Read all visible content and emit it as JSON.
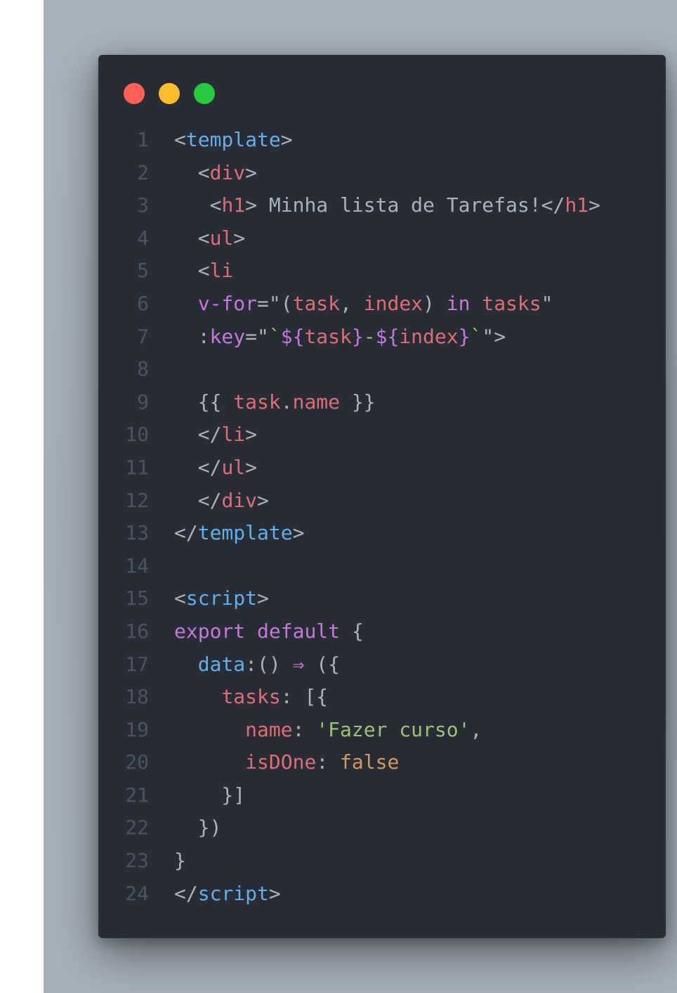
{
  "window_controls": {
    "close_color": "#ff5f56",
    "minimize_color": "#ffbd2e",
    "maximize_color": "#27c93f"
  },
  "code_lines": [
    {
      "n": "1",
      "tokens": [
        [
          "t-pun",
          "<"
        ],
        [
          "t-fn",
          "template"
        ],
        [
          "t-pun",
          ">"
        ]
      ]
    },
    {
      "n": "2",
      "tokens": [
        [
          "t-pun",
          "  <"
        ],
        [
          "t-tag",
          "div"
        ],
        [
          "t-pun",
          ">"
        ]
      ]
    },
    {
      "n": "3",
      "tokens": [
        [
          "t-pun",
          "   <"
        ],
        [
          "t-tag",
          "h1"
        ],
        [
          "t-pun",
          "> "
        ],
        [
          "t-txt",
          "Minha lista de Tarefas!"
        ],
        [
          "t-pun",
          "</"
        ],
        [
          "t-tag",
          "h1"
        ],
        [
          "t-pun",
          ">"
        ]
      ]
    },
    {
      "n": "4",
      "tokens": [
        [
          "t-pun",
          "  <"
        ],
        [
          "t-tag",
          "ul"
        ],
        [
          "t-pun",
          ">"
        ]
      ]
    },
    {
      "n": "5",
      "tokens": [
        [
          "t-pun",
          "  <"
        ],
        [
          "t-tag",
          "li"
        ]
      ]
    },
    {
      "n": "6",
      "tokens": [
        [
          "t-pun",
          "  "
        ],
        [
          "t-kw",
          "v-for"
        ],
        [
          "t-pun",
          "=\"("
        ],
        [
          "t-tag",
          "task"
        ],
        [
          "t-pun",
          ", "
        ],
        [
          "t-tag",
          "index"
        ],
        [
          "t-pun",
          ") "
        ],
        [
          "t-kw",
          "in"
        ],
        [
          "t-pun",
          " "
        ],
        [
          "t-tag",
          "tasks"
        ],
        [
          "t-pun",
          "\""
        ]
      ]
    },
    {
      "n": "7",
      "tokens": [
        [
          "t-pun",
          "  :"
        ],
        [
          "t-kw",
          "key"
        ],
        [
          "t-pun",
          "=\""
        ],
        [
          "t-str",
          "`"
        ],
        [
          "t-kw",
          "${"
        ],
        [
          "t-tag",
          "task"
        ],
        [
          "t-kw",
          "}"
        ],
        [
          "t-str",
          "-"
        ],
        [
          "t-kw",
          "${"
        ],
        [
          "t-tag",
          "index"
        ],
        [
          "t-kw",
          "}"
        ],
        [
          "t-str",
          "`"
        ],
        [
          "t-pun",
          "\">"
        ]
      ]
    },
    {
      "n": "8",
      "tokens": []
    },
    {
      "n": "9",
      "tokens": [
        [
          "t-pun",
          "  {{ "
        ],
        [
          "t-tag",
          "task"
        ],
        [
          "t-pun",
          "."
        ],
        [
          "t-tag",
          "name"
        ],
        [
          "t-pun",
          " }}"
        ]
      ]
    },
    {
      "n": "10",
      "tokens": [
        [
          "t-pun",
          "  </"
        ],
        [
          "t-tag",
          "li"
        ],
        [
          "t-pun",
          ">"
        ]
      ]
    },
    {
      "n": "11",
      "tokens": [
        [
          "t-pun",
          "  </"
        ],
        [
          "t-tag",
          "ul"
        ],
        [
          "t-pun",
          ">"
        ]
      ]
    },
    {
      "n": "12",
      "tokens": [
        [
          "t-pun",
          "  </"
        ],
        [
          "t-tag",
          "div"
        ],
        [
          "t-pun",
          ">"
        ]
      ]
    },
    {
      "n": "13",
      "tokens": [
        [
          "t-pun",
          "</"
        ],
        [
          "t-fn",
          "template"
        ],
        [
          "t-pun",
          ">"
        ]
      ]
    },
    {
      "n": "14",
      "tokens": []
    },
    {
      "n": "15",
      "tokens": [
        [
          "t-pun",
          "<"
        ],
        [
          "t-fn",
          "script"
        ],
        [
          "t-pun",
          ">"
        ]
      ]
    },
    {
      "n": "16",
      "tokens": [
        [
          "t-kw",
          "export"
        ],
        [
          "t-pun",
          " "
        ],
        [
          "t-kw",
          "default"
        ],
        [
          "t-pun",
          " {"
        ]
      ]
    },
    {
      "n": "17",
      "tokens": [
        [
          "t-pun",
          "  "
        ],
        [
          "t-fn",
          "data"
        ],
        [
          "t-pun",
          ":() "
        ],
        [
          "t-op",
          "⇒"
        ],
        [
          "t-pun",
          " ({"
        ]
      ]
    },
    {
      "n": "18",
      "tokens": [
        [
          "t-pun",
          "    "
        ],
        [
          "t-prop",
          "tasks"
        ],
        [
          "t-pun",
          ": [{"
        ]
      ]
    },
    {
      "n": "19",
      "tokens": [
        [
          "t-pun",
          "      "
        ],
        [
          "t-prop",
          "name"
        ],
        [
          "t-pun",
          ": "
        ],
        [
          "t-str",
          "'Fazer curso'"
        ],
        [
          "t-pun",
          ","
        ]
      ]
    },
    {
      "n": "20",
      "tokens": [
        [
          "t-pun",
          "      "
        ],
        [
          "t-prop",
          "isDOne"
        ],
        [
          "t-pun",
          ": "
        ],
        [
          "t-num",
          "false"
        ]
      ]
    },
    {
      "n": "21",
      "tokens": [
        [
          "t-pun",
          "    }]"
        ]
      ]
    },
    {
      "n": "22",
      "tokens": [
        [
          "t-pun",
          "  })"
        ]
      ]
    },
    {
      "n": "23",
      "tokens": [
        [
          "t-pun",
          "}"
        ]
      ]
    },
    {
      "n": "24",
      "tokens": [
        [
          "t-pun",
          "</"
        ],
        [
          "t-fn",
          "script"
        ],
        [
          "t-pun",
          ">"
        ]
      ]
    }
  ]
}
